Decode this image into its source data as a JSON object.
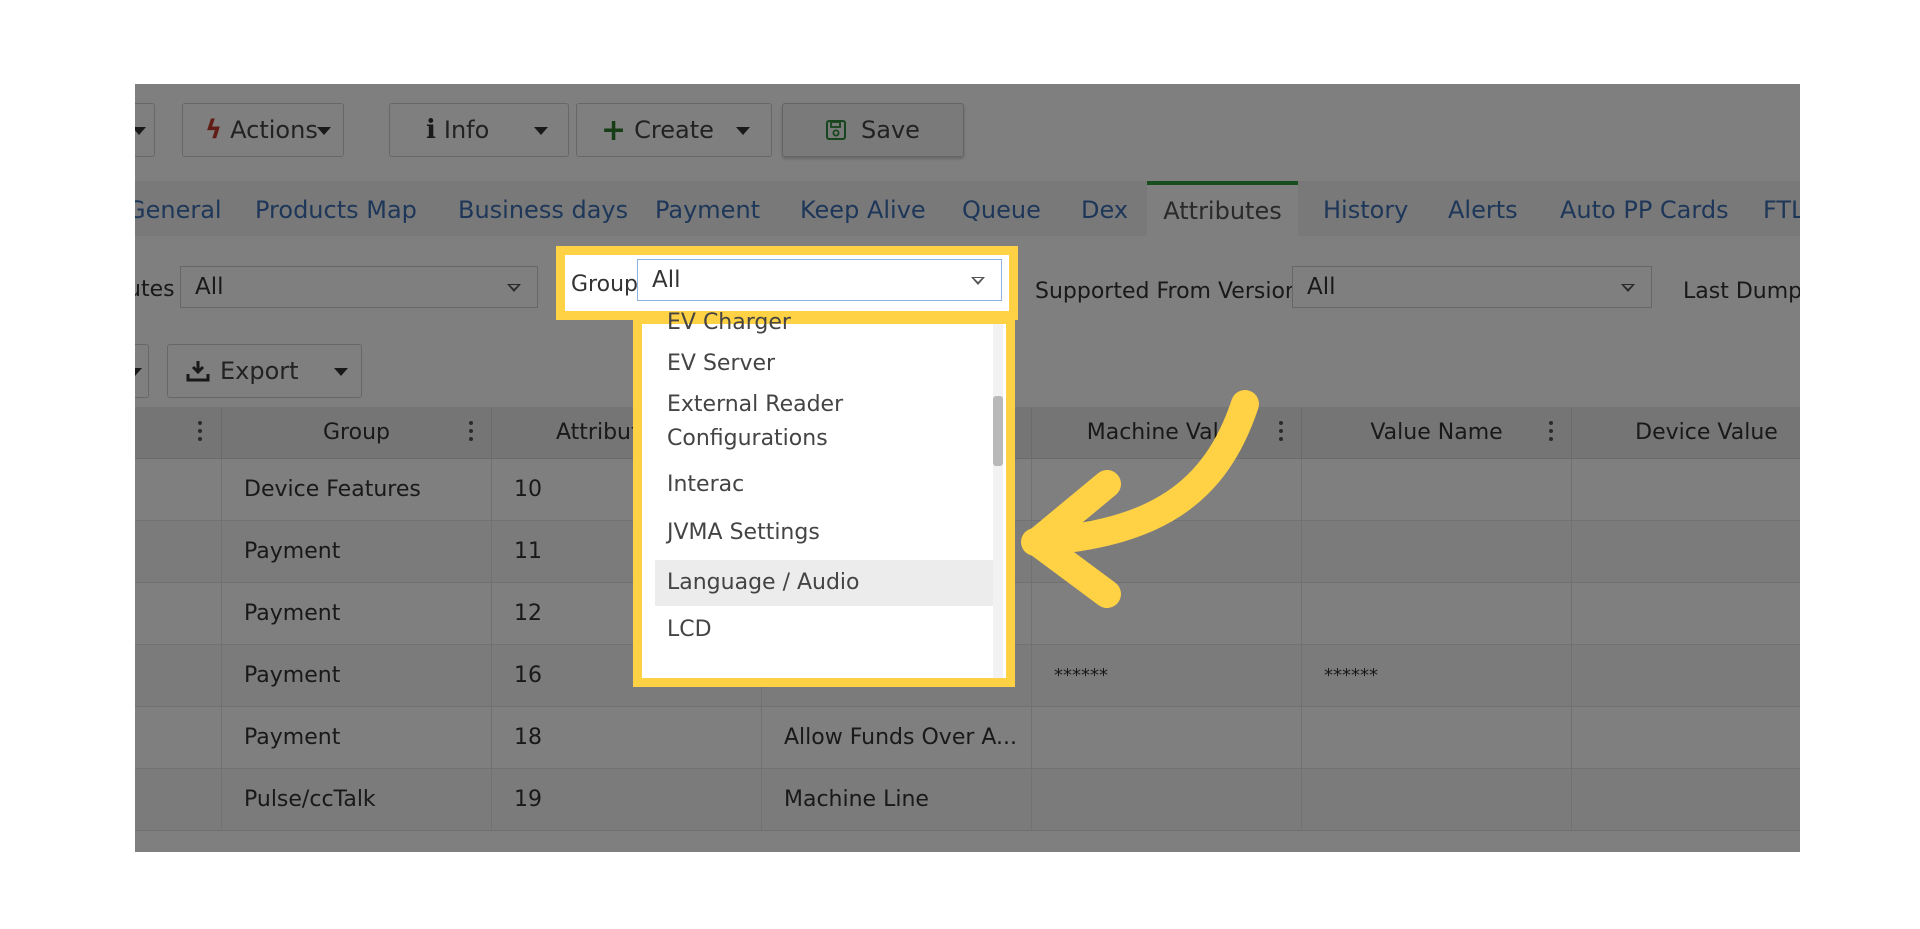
{
  "toolbar": {
    "actions_label": "Actions",
    "info_label": "Info",
    "create_label": "Create",
    "save_label": "Save"
  },
  "tabs": [
    {
      "label": "General"
    },
    {
      "label": "Products Map"
    },
    {
      "label": "Business days"
    },
    {
      "label": "Payment"
    },
    {
      "label": "Keep Alive"
    },
    {
      "label": "Queue"
    },
    {
      "label": "Dex"
    },
    {
      "label": "Attributes"
    },
    {
      "label": "History"
    },
    {
      "label": "Alerts"
    },
    {
      "label": "Auto PP Cards"
    },
    {
      "label": "FTL"
    }
  ],
  "filters": {
    "attributes_label": "utes",
    "attributes_value": "All",
    "group_label": "Group",
    "group_value": "All",
    "version_label": "Supported From Version",
    "version_value": "All",
    "last_dump_label": "Last Dump:"
  },
  "group_dropdown": {
    "options": [
      "EV Charger",
      "EV Server",
      "External Reader",
      "Configurations",
      "Interac",
      "JVMA Settings",
      "Language / Audio",
      "LCD"
    ],
    "hovered": "Language / Audio"
  },
  "export_label": "Export",
  "grid": {
    "headers": [
      "Group",
      "Attribut",
      "Machine Value",
      "Value Name",
      "Device Value"
    ],
    "rows": [
      {
        "group": "Device Features",
        "attr": "10",
        "name": "",
        "machine_value": "",
        "value_name": ""
      },
      {
        "group": "Payment",
        "attr": "11",
        "name": "",
        "machine_value": "",
        "value_name": ""
      },
      {
        "group": "Payment",
        "attr": "12",
        "name": "",
        "machine_value": "",
        "value_name": ""
      },
      {
        "group": "Payment",
        "attr": "16",
        "name": "",
        "machine_value": "******",
        "value_name": "******"
      },
      {
        "group": "Payment",
        "attr": "18",
        "name": "Allow Funds Over A...",
        "machine_value": "",
        "value_name": ""
      },
      {
        "group": "Pulse/ccTalk",
        "attr": "19",
        "name": "Machine Line",
        "machine_value": "",
        "value_name": ""
      }
    ]
  },
  "colors": {
    "highlight": "#ffd144",
    "active_tab_border": "#2e9a3f",
    "tab_link": "#3c6fb3"
  }
}
